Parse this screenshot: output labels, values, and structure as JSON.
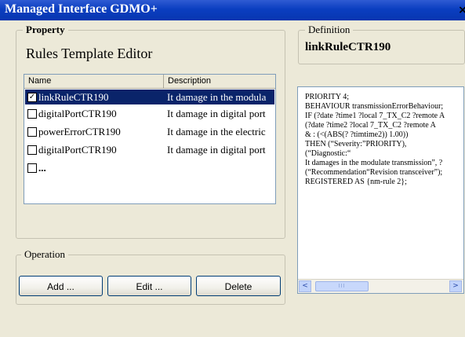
{
  "window": {
    "title": "Managed Interface GDMO+",
    "close_symbol": "×"
  },
  "property": {
    "group_label": "Property",
    "heading": "Rules Template Editor",
    "list": {
      "columns": [
        "Name",
        "Description"
      ],
      "rows": [
        {
          "name": "linkRuleCTR190",
          "description": "It damage in the modula",
          "checked": true,
          "selected": true
        },
        {
          "name": "digitalPortCTR190",
          "description": "It damage in digital port",
          "checked": false,
          "selected": false
        },
        {
          "name": "powerErrorCTR190",
          "description": "It damage in the electric",
          "checked": false,
          "selected": false
        },
        {
          "name": "digitalPortCTR190",
          "description": "It damage in digital port",
          "checked": false,
          "selected": false
        },
        {
          "name": "...",
          "description": "",
          "checked": false,
          "selected": false
        }
      ]
    }
  },
  "operation": {
    "group_label": "Operation",
    "add_label": "Add ...",
    "edit_label": "Edit ...",
    "delete_label": "Delete"
  },
  "definition": {
    "group_label": "Definition",
    "rule_name": "linkRuleCTR190",
    "code_lines": [
      "PRIORITY 4;",
      " BEHAVIOUR transmissionErrorBehaviour;",
      " IF (?date ?time1 ?local 7_TX_C2 ?remote A",
      "    (?date ?time2 ?local 7_TX_C2 ?remote A",
      "       & : (<(ABS(? ?timtime2)) 1.00))",
      " THEN (“Severity:”PRIORITY),",
      " (“Diagnostic:“",
      "    It damages in the modulate transmission”, ?",
      " (“Recommendation“Revision transceiver”);",
      "REGISTERED AS {nm-rule 2};"
    ],
    "scroll_left_symbol": "<",
    "scroll_right_symbol": ">",
    "scroll_thumb_grip": "III"
  }
}
